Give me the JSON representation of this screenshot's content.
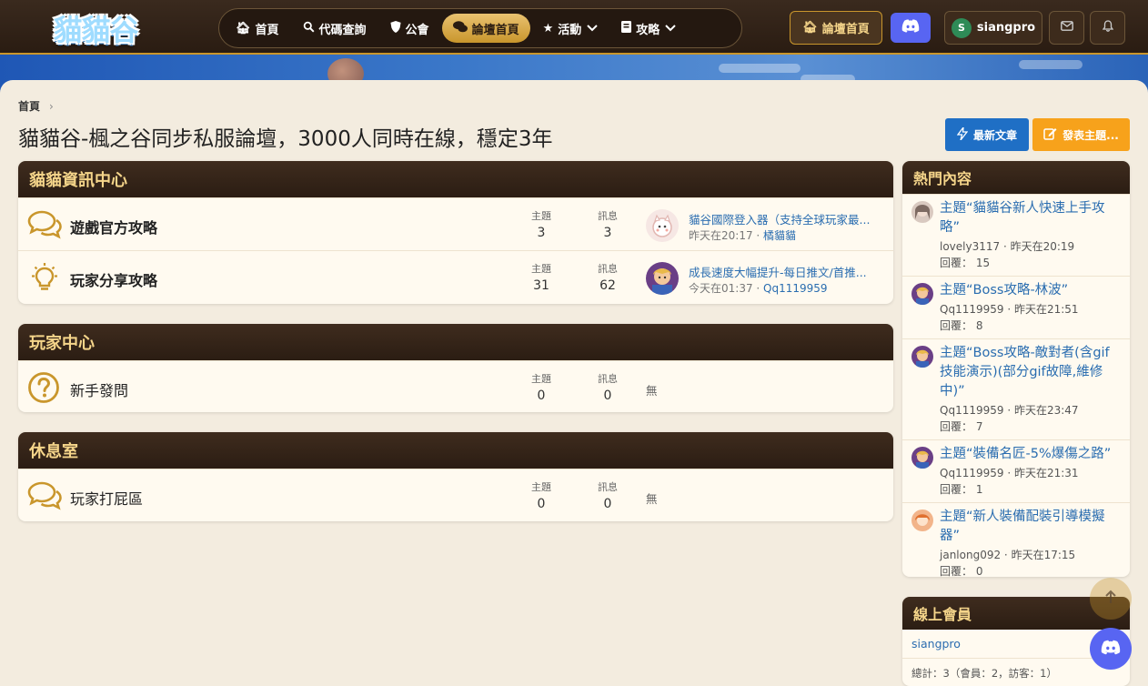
{
  "header": {
    "logo_text": "貓貓谷",
    "nav": [
      {
        "label": "首頁",
        "icon": "home-icon"
      },
      {
        "label": "代碼查詢",
        "icon": "search-icon"
      },
      {
        "label": "公會",
        "icon": "shield-icon"
      },
      {
        "label": "論壇首頁",
        "icon": "comments-icon",
        "active": true
      },
      {
        "label": "活動",
        "icon": "star-icon",
        "dropdown": true
      },
      {
        "label": "攻略",
        "icon": "book-icon",
        "dropdown": true
      }
    ],
    "forum_home_label": "論壇首頁",
    "user": {
      "initial": "S",
      "name": "siangpro"
    }
  },
  "breadcrumb": {
    "home": "首頁"
  },
  "page_title": "貓貓谷-楓之谷同步私服論壇，3000人同時在線，穩定3年",
  "actions": {
    "latest": "最新文章",
    "post": "發表主題..."
  },
  "categories": [
    {
      "title": "貓貓資訊中心",
      "nodes": [
        {
          "title": "遊戲官方攻略",
          "icon": "comments-icon",
          "threads_label": "主題",
          "threads": "3",
          "msgs_label": "訊息",
          "msgs": "3",
          "last_title": "貓谷國際登入器（支持全球玩家最...",
          "last_time": "昨天在20:17",
          "last_user": "橘貓貓"
        },
        {
          "title": "玩家分享攻略",
          "icon": "lightbulb-icon",
          "threads_label": "主題",
          "threads": "31",
          "msgs_label": "訊息",
          "msgs": "62",
          "last_title": "成長速度大幅提升-每日推文/首推...",
          "last_time": "今天在01:37",
          "last_user": "Qq1119959"
        }
      ]
    },
    {
      "title": "玩家中心",
      "nodes": [
        {
          "title": "新手發問",
          "icon": "question-icon",
          "threads_label": "主題",
          "threads": "0",
          "msgs_label": "訊息",
          "msgs": "0",
          "none": "無"
        }
      ]
    },
    {
      "title": "休息室",
      "nodes": [
        {
          "title": "玩家打屁區",
          "icon": "comments-icon",
          "threads_label": "主題",
          "threads": "0",
          "msgs_label": "訊息",
          "msgs": "0",
          "none": "無"
        }
      ]
    }
  ],
  "sidebar": {
    "hot_title": "熱門內容",
    "hot": [
      {
        "title": "主題“貓貓谷新人快速上手攻略”",
        "user": "lovely3117",
        "time": "昨天在20:19",
        "reply_label": "回覆：",
        "replies": "15"
      },
      {
        "title": "主題“Boss攻略-林波”",
        "user": "Qq1119959",
        "time": "昨天在21:51",
        "reply_label": "回覆：",
        "replies": "8"
      },
      {
        "title": "主題“Boss攻略-敵對者(含gif技能演示)(部分gif故障,維修中)”",
        "user": "Qq1119959",
        "time": "昨天在23:47",
        "reply_label": "回覆：",
        "replies": "7"
      },
      {
        "title": "主題“裝備名匠-5%爆傷之路”",
        "user": "Qq1119959",
        "time": "昨天在21:31",
        "reply_label": "回覆：",
        "replies": "1"
      },
      {
        "title": "主題“新人裝備配裝引導模擬器”",
        "user": "janlong092",
        "time": "昨天在17:15",
        "reply_label": "回覆：",
        "replies": "0"
      }
    ],
    "online_title": "線上會員",
    "online_users": "siangpro",
    "online_total": "總計：3（會員：2，訪客：1）"
  }
}
